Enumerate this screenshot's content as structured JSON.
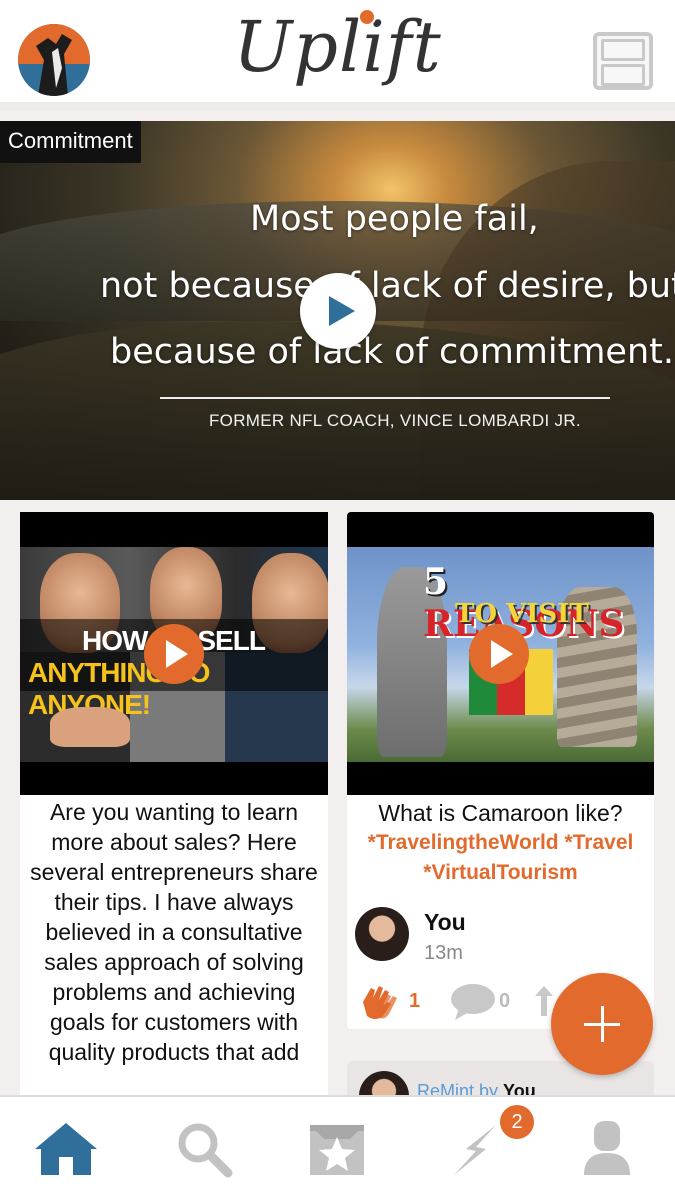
{
  "header": {
    "title": "Uplift"
  },
  "hero": {
    "tag": "Commitment",
    "quote_line1": "Most people fail,",
    "quote_line2": "not because of lack of desire, but",
    "quote_line3": "because of lack of commitment.",
    "attribution": "FORMER NFL COACH, VINCE LOMBARDI JR."
  },
  "cards": [
    {
      "thumb_line1": "HOW TO SELL",
      "thumb_line2": "ANYTHING TO ANYONE!",
      "description": "Are you wanting to learn more about sales? Here several entrepreneurs share their tips. I have always believed in a consultative sales approach of solving problems and achieving goals for customers with quality products that add"
    },
    {
      "thumb_number": "5",
      "thumb_line1": "REASONS",
      "thumb_line2": "TO VISIT",
      "description": "What is Camaroon like?",
      "tags": "*TravelingtheWorld *Travel *VirtualTourism",
      "author": "You",
      "time": "13m",
      "claps": "1",
      "comments": "0"
    }
  ],
  "remint": {
    "label": "ReMint by",
    "user": "You"
  },
  "nav": {
    "activity_badge": "2"
  },
  "colors": {
    "accent": "#e26a2c",
    "primary_blue": "#2f6f9a",
    "link_blue": "#5a9bd5"
  }
}
